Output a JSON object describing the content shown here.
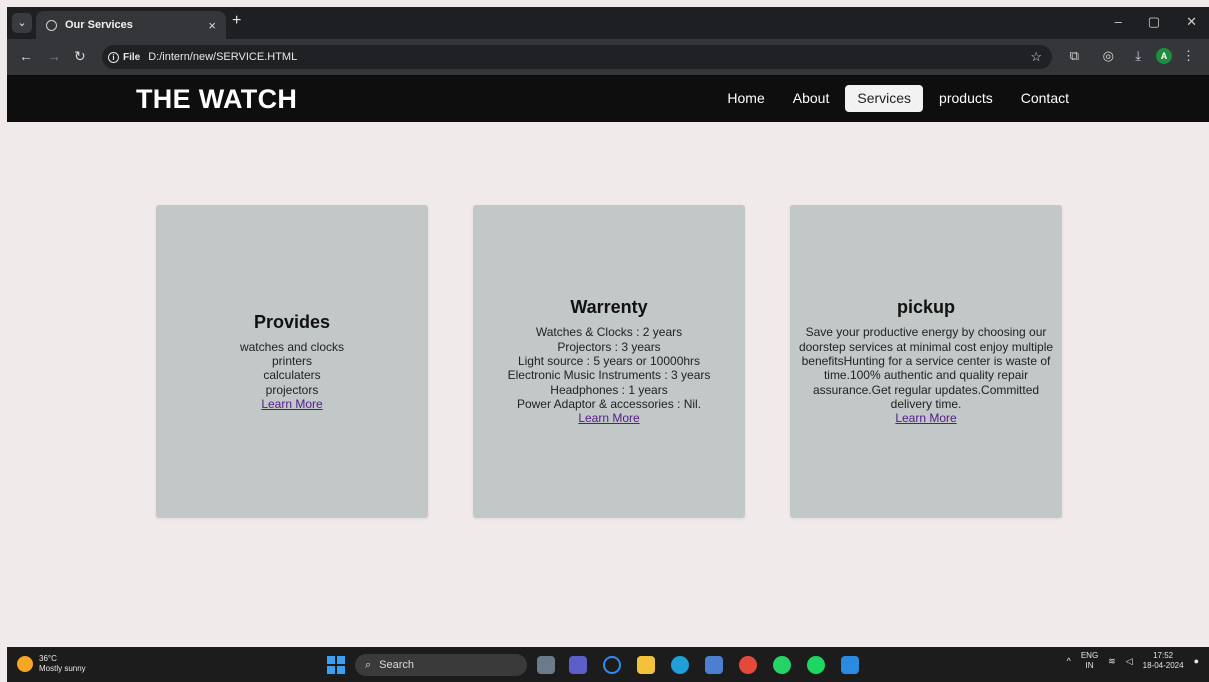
{
  "browser": {
    "tab_title": "Our Services",
    "tab_close": "×",
    "new_tab": "+",
    "address_chip": "File",
    "url": "D:/intern/new/SERVICE.HTML",
    "window_controls": [
      "–",
      "▢",
      "✕"
    ],
    "profile_initial": "A"
  },
  "site": {
    "logo": "THE WATCH",
    "nav": [
      {
        "label": "Home"
      },
      {
        "label": "About"
      },
      {
        "label": "Services",
        "active": true
      },
      {
        "label": "products"
      },
      {
        "label": "Contact"
      }
    ]
  },
  "cards": [
    {
      "title": "Provides",
      "lines": [
        "watches and clocks",
        "printers",
        "calculaters",
        "projectors"
      ],
      "link": "Learn More"
    },
    {
      "title": "Warrenty",
      "lines": [
        "Watches & Clocks : 2 years",
        "Projectors : 3 years",
        "Light source : 5 years or 10000hrs",
        "Electronic Music Instruments : 3 years",
        "Headphones : 1 years",
        "Power Adaptor & accessories : Nil."
      ],
      "link": "Learn More"
    },
    {
      "title": "pickup",
      "paragraph": "Save your productive energy by choosing our doorstep services at minimal cost enjoy multiple benefitsHunting for a service center is waste of time.100% authentic and quality repair assurance.Get regular updates.Committed delivery time.",
      "link": "Learn More"
    }
  ],
  "taskbar": {
    "temperature": "36°C",
    "weather": "Mostly sunny",
    "search_label": "Search",
    "lang_top": "ENG",
    "lang_bottom": "IN",
    "time": "17:52",
    "date": "18-04-2024"
  },
  "colors": {
    "page_bg": "#f0eaea",
    "header_bg": "#0e0e0e",
    "card_bg": "#c2c7c8",
    "link": "#551a8b"
  }
}
